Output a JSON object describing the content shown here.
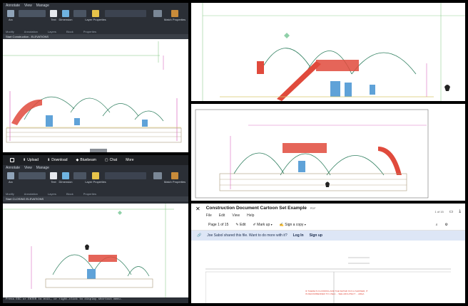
{
  "top_left": {
    "menu_tabs": [
      "Annotate",
      "View",
      "Manage"
    ],
    "tools": [
      "Arc",
      "Text",
      "Dimension",
      "Layer Properties",
      "Match Properties"
    ],
    "groups": [
      "Modify",
      "Annotation",
      "Layers",
      "Block",
      "Properties"
    ],
    "file_tab": "Start   Construction - ELEVATIONS",
    "file_tab_short": "CLOSING ELEVATIONS"
  },
  "bottom_left": {
    "menu_tabs": [
      "Annotate",
      "View",
      "Manage"
    ],
    "tools": [
      "Arc",
      "Text",
      "Dimension",
      "Layer Properties",
      "Match Properties"
    ],
    "groups": [
      "Modify",
      "Annotation",
      "Layers",
      "Block",
      "Properties"
    ],
    "file_tab": "Start   CLOSING ELEVATIONS",
    "toolbar": {
      "upload": "Upload",
      "download": "Download",
      "bluebeam": "Bluebeam",
      "chat": "Chat",
      "more": "More"
    },
    "status": "Press ESC or ENTER to exit, or right-click to display shortcut menu."
  },
  "doc_viewer": {
    "title": "Construction Document Cartoon Set Example",
    "file_type": "PDF",
    "menu": [
      "File",
      "Edit",
      "View",
      "Help"
    ],
    "page_indicator": "1 of 15",
    "page_label": "Page 1 of 15",
    "edit": "Edit",
    "markup": "Mark up",
    "sign": "Sign a copy",
    "share_message": "Joe Sabol shared this file. Want to do more with it?",
    "login": "Log In",
    "signup": "Sign up",
    "note": "IF THERE IS FLOODING AND THE WATER IS IN A SHOWER, IT IS RECOMMENDED TO USE A ... SEE ARCHITECT ... AREA"
  },
  "colors": {
    "red_railing": "#e04a3c",
    "dome_line": "#2f7f5f",
    "wall_line": "#a99a7a",
    "magenta_dim": "#d44bb4",
    "yellow_hatch": "#d9c86a"
  }
}
